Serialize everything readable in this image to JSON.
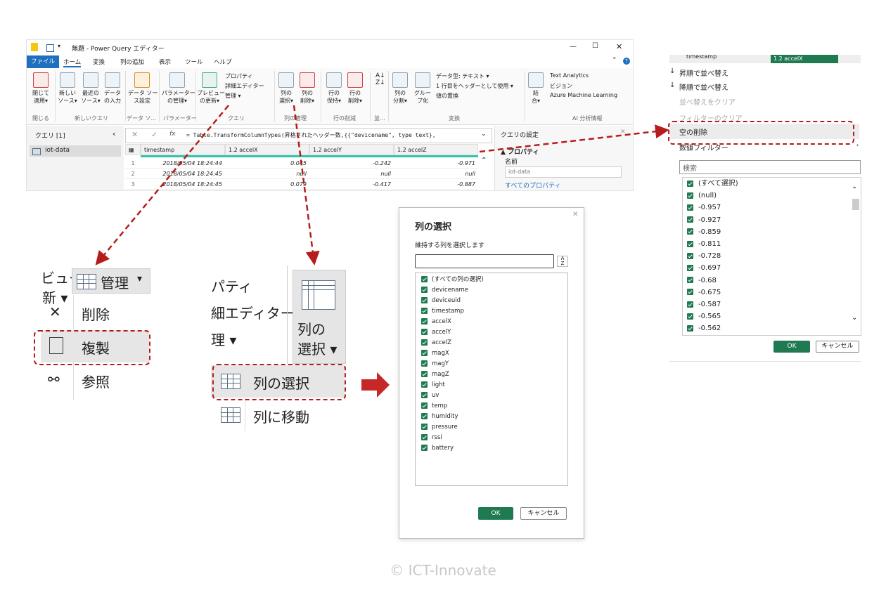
{
  "window": {
    "title": "無題 - Power Query エディター",
    "controls": [
      "—",
      "☐",
      "✕"
    ],
    "tabs": [
      "ファイル",
      "ホーム",
      "変換",
      "列の追加",
      "表示",
      "ツール",
      "ヘルプ"
    ],
    "ribbon": {
      "close_apply": "閉じて\n適用▾",
      "new_source": "新しい\nソース▾",
      "recent_source": "最近の\nソース▾",
      "data_entry": "データ\nの入力",
      "data_source_settings": "データ ソー\nス設定",
      "param_manage": "パラメーター\nの管理▾",
      "preview_refresh": "プレビュー\nの更新▾",
      "properties": "プロパティ",
      "advanced_editor": "詳細エディター",
      "manage": "管理 ▾",
      "choose_columns": "列の\n選択▾",
      "remove_columns": "列の\n削除▾",
      "keep_rows": "行の\n保持▾",
      "remove_rows": "行の\n削除▾",
      "split_column": "列の\n分割▾",
      "group_by": "グルー\nプ化",
      "data_type": "データ型: テキスト ▾",
      "first_row_header": "1 行目をヘッダーとして使用 ▾",
      "replace_values": "値の置換",
      "combine": "結\n合▾",
      "text_analytics": "Text Analytics",
      "vision": "ビジョン",
      "azure_ml": "Azure Machine Learning",
      "groups": [
        "閉じる",
        "新しいクエリ",
        "データ ソ...",
        "パラメーター",
        "クエリ",
        "列の管理",
        "行の削減",
        "並...",
        "変換",
        "AI 分析情報"
      ]
    },
    "queries_title": "クエリ [1]",
    "query_item": "iot-data",
    "formula": "= Table.TransformColumnTypes(昇格されたヘッダー数,{{\"devicename\", type text},",
    "fx": "fx",
    "grid": {
      "headers": [
        "timestamp",
        "accelX",
        "accelY",
        "accelZ"
      ],
      "type_labels": [
        "",
        "1.2",
        "1.2",
        "1.2"
      ],
      "rows": [
        [
          "1",
          "2018/05/04 18:24:44",
          "0.045",
          "-0.242",
          "-0.971"
        ],
        [
          "2",
          "2018/05/04 18:24:45",
          "null",
          "null",
          "null"
        ],
        [
          "3",
          "2018/05/04 18:24:45",
          "0.079",
          "-0.417",
          "-0.887"
        ]
      ]
    },
    "settings": {
      "title": "クエリの設定",
      "properties": "▲ プロパティ",
      "name_label": "名前",
      "name_value": "iot-data",
      "all_properties": "すべてのプロパティ"
    }
  },
  "manage_zoom": {
    "partial_top": "ビュー",
    "partial_bottom": "新 ▾",
    "manage": "管理",
    "items": [
      "削除",
      "複製",
      "参照"
    ]
  },
  "colsel_zoom": {
    "partial": [
      "パティ",
      "細エディター",
      "理 ▾"
    ],
    "button": "列の\n選択 ▾",
    "items": [
      "列の選択",
      "列に移動"
    ]
  },
  "dialog": {
    "title": "列の選択",
    "subtitle": "維持する列を選択します",
    "search_value": "",
    "columns": [
      "(すべての列の選択)",
      "devicename",
      "deviceuid",
      "timestamp",
      "accelX",
      "accelY",
      "accelZ",
      "magX",
      "magY",
      "magZ",
      "light",
      "uv",
      "temp",
      "humidity",
      "pressure",
      "rssi",
      "battery"
    ],
    "ok": "OK",
    "cancel": "キャンセル"
  },
  "filter": {
    "header_col": "timestamp",
    "header_next": "1.2  accelX",
    "sort_asc": "昇順で並べ替え",
    "sort_desc": "降順で並べ替え",
    "clear_sort": "並べ替えをクリア",
    "clear_filter": "フィルターのクリア",
    "remove_empty": "空の削除",
    "number_filters": "数値フィルター",
    "search_placeholder": "検索",
    "values": [
      "(すべて選択)",
      "(null)",
      "-0.957",
      "-0.927",
      "-0.859",
      "-0.811",
      "-0.728",
      "-0.697",
      "-0.68",
      "-0.675",
      "-0.587",
      "-0.565",
      "-0.562"
    ],
    "ok": "OK",
    "cancel": "キャンセル"
  },
  "copyright": "© ICT-Innovate",
  "colors": {
    "accent_red": "#b71c1c",
    "ok_green": "#1f7a52",
    "ribbon_blue": "#1f6fbf"
  }
}
